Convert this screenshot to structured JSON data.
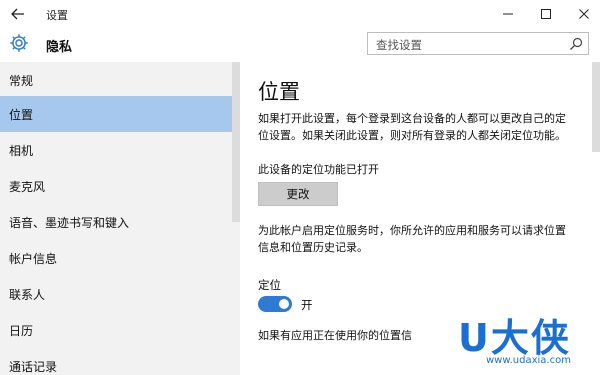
{
  "window": {
    "title": "设置"
  },
  "header": {
    "title": "隐私",
    "search_placeholder": "查找设置"
  },
  "sidebar": {
    "items": [
      {
        "label": "常规",
        "active": false
      },
      {
        "label": "位置",
        "active": true
      },
      {
        "label": "相机",
        "active": false
      },
      {
        "label": "麦克风",
        "active": false
      },
      {
        "label": "语音、墨迹书写和键入",
        "active": false
      },
      {
        "label": "帐户信息",
        "active": false
      },
      {
        "label": "联系人",
        "active": false
      },
      {
        "label": "日历",
        "active": false
      },
      {
        "label": "通话记录",
        "active": false
      }
    ]
  },
  "content": {
    "title": "位置",
    "intro_line1": "如果打开此设置，每个登录到这台设备的人都可以更改自己的定",
    "intro_line2": "位设置。如果关闭此设置，则对所有登录的人都关闭定位功能。",
    "device_status": "此设备的定位功能已打开",
    "change_button": "更改",
    "service_line1": "为此帐户启用定位服务时，你所允许的应用和服务可以请求位置",
    "service_line2": "信息和位置历史记录。",
    "location_label": "定位",
    "location_toggle_on": true,
    "location_toggle_text": "开",
    "bottom_text": "如果有应用正在使用你的位置信"
  },
  "watermark": {
    "brand": "U大侠",
    "url": "www.udaxia.com"
  },
  "colors": {
    "accent": "#2f7ad4",
    "sidebar_bg": "#f2f2f2",
    "active_item_bg": "#a6c8ec",
    "watermark": "#1b6fd1"
  },
  "icons": {
    "back": "back-arrow-icon",
    "settings": "gear-icon",
    "search": "search-icon",
    "minimize": "minimize-icon",
    "maximize": "maximize-icon",
    "close": "close-icon"
  }
}
